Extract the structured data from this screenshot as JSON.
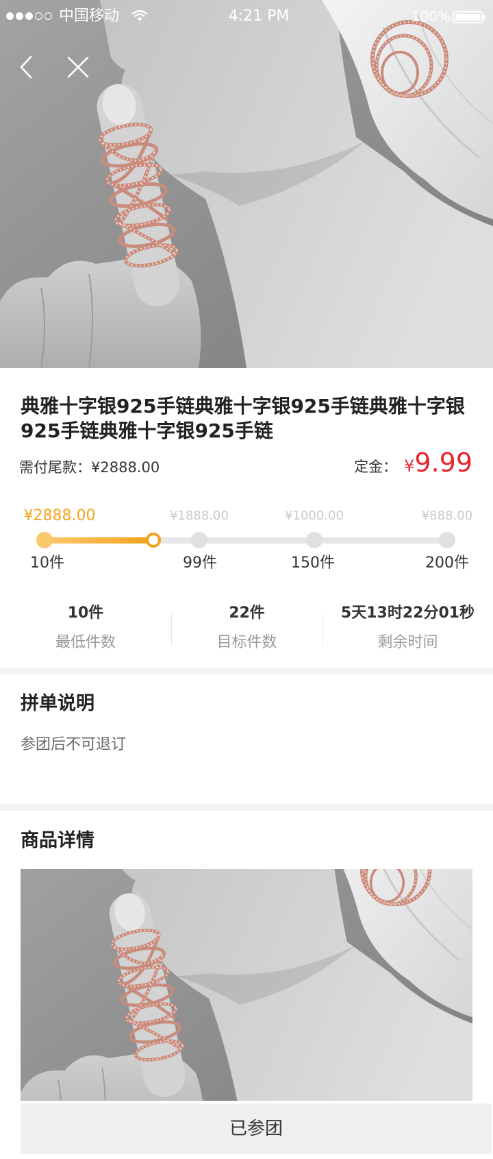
{
  "status_bar": {
    "carrier": "中国移动",
    "time": "4:21 PM",
    "battery": "100%",
    "battery_level": 1,
    "signal_bars": 3,
    "signal_total": 5
  },
  "icons": {
    "signal": "signal-strength-icon",
    "wifi": "wifi-icon",
    "battery": "battery-icon",
    "back": "chevron-left-icon",
    "close": "close-icon"
  },
  "product": {
    "title": "典雅十字银925手链典雅十字银925手链典雅十字银925手链典雅十字银925手链",
    "balance_label": "需付尾款：",
    "balance_amount": "¥2888.00",
    "deposit_label": "定金：",
    "deposit_currency": "¥",
    "deposit_amount": "9.99"
  },
  "tiers": [
    {
      "price": "¥2888.00",
      "quantity": "10件",
      "reached": true
    },
    {
      "price": "¥1888.00",
      "quantity": "99件",
      "reached": false
    },
    {
      "price": "¥1000.00",
      "quantity": "150件",
      "reached": false
    },
    {
      "price": "¥888.00",
      "quantity": "200件",
      "reached": false
    }
  ],
  "progress": 0.27,
  "stats": [
    {
      "value": "10件",
      "label": "最低件数"
    },
    {
      "value": "22件",
      "label": "目标件数"
    },
    {
      "value": "5天13时22分01秒",
      "label": "剩余时间"
    }
  ],
  "group_notes": {
    "heading": "拼单说明",
    "text": "参团后不可退订"
  },
  "product_details": {
    "heading": "商品详情"
  },
  "action": {
    "label": "已参团"
  },
  "colors": {
    "accent": "#f5a21b",
    "accent_light": "#fcc86c",
    "price": "#e8232b",
    "muted_price": "#c9c9c9"
  }
}
